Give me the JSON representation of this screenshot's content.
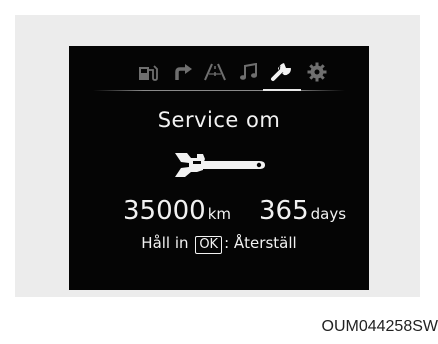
{
  "screen": {
    "tabs": [
      {
        "name": "trip-computer",
        "icon": "fuel-pump-icon",
        "active": false
      },
      {
        "name": "navigation",
        "icon": "turn-arrow-icon",
        "active": false
      },
      {
        "name": "lane-assist",
        "icon": "road-icon",
        "active": false
      },
      {
        "name": "audio",
        "icon": "music-note-icon",
        "active": false
      },
      {
        "name": "service",
        "icon": "wrench-icon",
        "active": true
      },
      {
        "name": "settings",
        "icon": "gear-icon",
        "active": false
      }
    ],
    "title": "Service om",
    "distance_value": "35000",
    "distance_unit": "km",
    "days_value": "365",
    "days_unit": "days",
    "reset_prefix": "Håll in",
    "reset_key": "OK",
    "reset_suffix": ": Återställ"
  },
  "caption": "OUM044258SW",
  "colors": {
    "screen_bg": "#050505",
    "text": "#f2f2f2",
    "inactive_icon": "#6f6f6f",
    "panel_bg": "#ececec"
  }
}
